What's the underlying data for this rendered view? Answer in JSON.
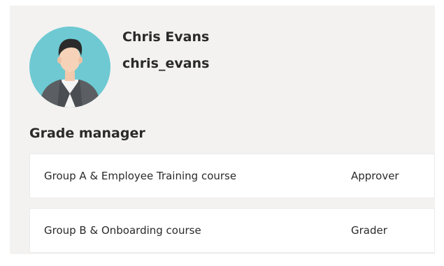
{
  "user": {
    "name": "Chris Evans",
    "username": "chris_evans",
    "avatar_icon": "person-avatar-icon"
  },
  "grade_manager": {
    "title": "Grade manager",
    "rows": [
      {
        "group": "Group A & Employee Training course",
        "role": "Approver"
      },
      {
        "group": "Group B & Onboarding course",
        "role": "Grader"
      }
    ]
  },
  "colors": {
    "panel_background": "#f3f2f1",
    "avatar_background": "#6ec9d2",
    "suit": "#5b5f63",
    "text": "#2a2a2a"
  }
}
